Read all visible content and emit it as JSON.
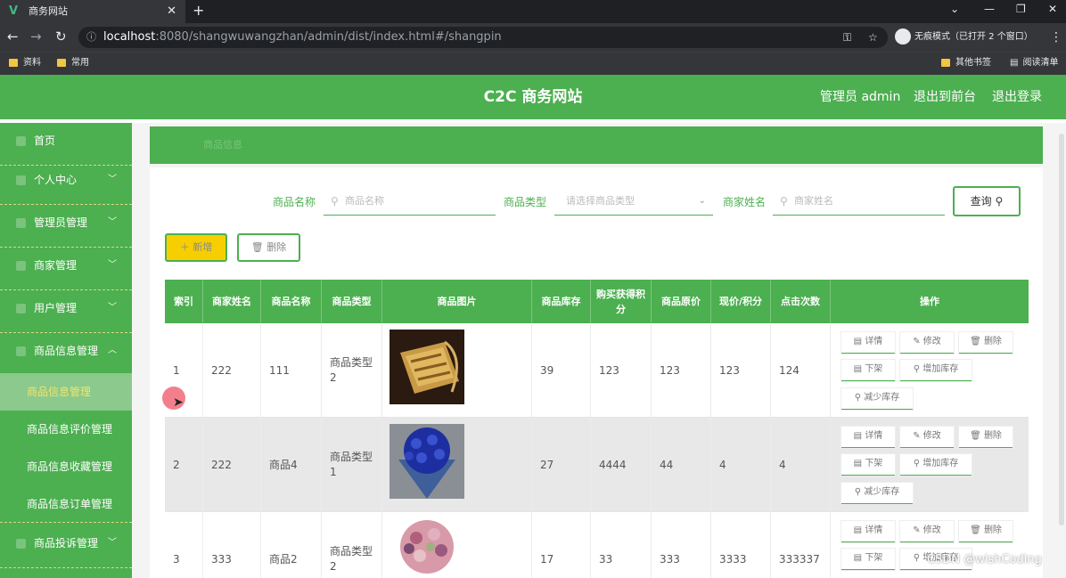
{
  "browser": {
    "tab_title": "商务网站",
    "tab_icon": "vue-logo-icon",
    "url_host": "localhost",
    "url_path": ":8080/shangwuwangzhan/admin/dist/index.html#/shangpin",
    "incognito_label": "无痕模式（已打开 2 个窗口）",
    "bookmarks": [
      "资料",
      "常用"
    ],
    "other_bookmarks": "其他书签",
    "reading_list": "阅读清单"
  },
  "header": {
    "title": "C2C 商务网站",
    "admin_label": "管理员 admin",
    "front_link": "退出到前台",
    "logout_link": "退出登录"
  },
  "sidebar": {
    "items": [
      {
        "label": "首页"
      },
      {
        "label": "个人中心"
      },
      {
        "label": "管理员管理"
      },
      {
        "label": "商家管理"
      },
      {
        "label": "用户管理"
      },
      {
        "label": "商品信息管理"
      }
    ],
    "sub_items": [
      {
        "label": "商品信息管理"
      },
      {
        "label": "商品信息评价管理"
      },
      {
        "label": "商品信息收藏管理"
      },
      {
        "label": "商品信息订单管理"
      }
    ],
    "last_item": {
      "label": "商品投诉管理"
    }
  },
  "breadcrumb": "商品信息",
  "search": {
    "name_label": "商品名称",
    "name_placeholder": "商品名称",
    "type_label": "商品类型",
    "type_placeholder": "请选择商品类型",
    "merchant_label": "商家姓名",
    "merchant_placeholder": "商家姓名",
    "query_button": "查询"
  },
  "actions": {
    "add": "新增",
    "delete": "删除"
  },
  "table": {
    "headers": [
      "索引",
      "商家姓名",
      "商品名称",
      "商品类型",
      "商品图片",
      "商品库存",
      "购买获得积分",
      "商品原价",
      "现价/积分",
      "点击次数",
      "操作"
    ],
    "rows": [
      {
        "index": "1",
        "merchant": "222",
        "name": "111",
        "type": "商品类型2",
        "stock": "39",
        "points": "123",
        "price": "123",
        "current": "123",
        "clicks": "124"
      },
      {
        "index": "2",
        "merchant": "222",
        "name": "商品4",
        "type": "商品类型1",
        "stock": "27",
        "points": "4444",
        "price": "44",
        "current": "4",
        "clicks": "4"
      },
      {
        "index": "3",
        "merchant": "333",
        "name": "商品2",
        "type": "商品类型2",
        "stock": "17",
        "points": "33",
        "price": "333",
        "current": "3333",
        "clicks": "333337"
      }
    ],
    "op_buttons": {
      "detail": "详情",
      "edit": "修改",
      "delete": "删除",
      "offshelf": "下架",
      "add_stock": "增加库存",
      "reduce_stock": "减少库存"
    }
  },
  "watermark": "CSDN @wishCoding",
  "colors": {
    "primary": "#4caf50",
    "add_button": "#f7cf00",
    "active_sub": "#f3e56b"
  }
}
